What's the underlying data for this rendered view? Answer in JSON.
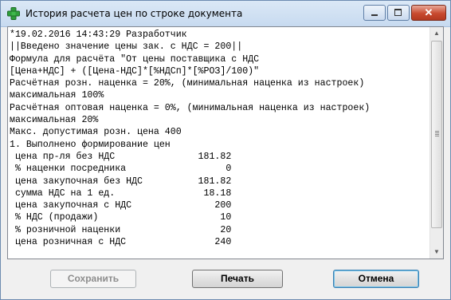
{
  "window": {
    "title": "История расчета цен по строке документа",
    "close_glyph": "✕"
  },
  "log_lines": [
    "*19.02.2016 14:43:29 Разработчик",
    "||Введено значение цены зак. с НДС = 200||",
    "Формула для расчёта \"От цены поставщика с НДС",
    "[Цена+НДС] + ([Цена-НДС]*[%НДСп]*[%РОЗ]/100)\"",
    "Расчётная розн. наценка = 20%, (минимальная наценка из настроек)",
    "максимальная 100%",
    "Расчётная оптовая наценка = 0%, (минимальная наценка из настроек)",
    "максимальная 20%",
    "Макс. допустимая розн. цена 400",
    "1. Выполнено формирование цен",
    " цена пр-ля без НДС               181.82",
    " % наценки посредника                  0",
    " цена закупочная без НДС          181.82",
    " сумма НДС на 1 ед.                18.18",
    " цена закупочная с НДС               200",
    " % НДС (продажи)                      10",
    " % розничной наценки                  20",
    " цена розничная с НДС                240"
  ],
  "scrollbar": {
    "up_glyph": "▲",
    "down_glyph": "▼"
  },
  "buttons": {
    "save": "Сохранить",
    "print": "Печать",
    "cancel": "Отмена"
  },
  "colors": {
    "titlebar": "#c7daf0",
    "close_button": "#c84a2f",
    "icon_green": "#2e9e3a"
  }
}
